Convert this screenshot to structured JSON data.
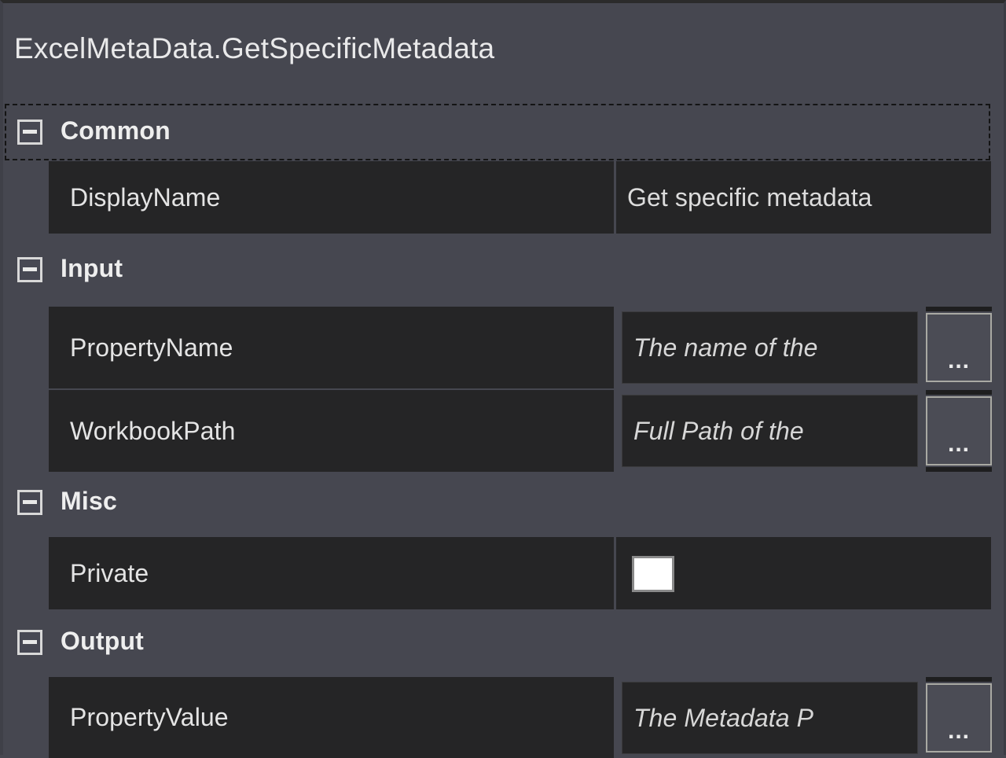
{
  "panel": {
    "title": "ExcelMetaData.GetSpecificMetadata"
  },
  "categories": [
    {
      "id": "common",
      "label": "Common",
      "expander_icon": "collapse-minus-icon",
      "expanded": true,
      "selected": true
    },
    {
      "id": "input",
      "label": "Input",
      "expander_icon": "collapse-minus-icon",
      "expanded": true,
      "selected": false
    },
    {
      "id": "misc",
      "label": "Misc",
      "expander_icon": "collapse-minus-icon",
      "expanded": true,
      "selected": false
    },
    {
      "id": "output",
      "label": "Output",
      "expander_icon": "collapse-minus-icon",
      "expanded": true,
      "selected": false
    }
  ],
  "properties": {
    "display_name": {
      "name": "DisplayName",
      "value": "Get specific metadata",
      "editor": "text"
    },
    "property_name": {
      "name": "PropertyName",
      "value": "The name of the",
      "placeholder": "The name of the",
      "editor": "expression",
      "browse_label": "..."
    },
    "workbook_path": {
      "name": "WorkbookPath",
      "value": "Full Path of the",
      "placeholder": "Full Path of the",
      "editor": "expression",
      "browse_label": "..."
    },
    "private": {
      "name": "Private",
      "value": "",
      "checked": false,
      "editor": "checkbox"
    },
    "property_value": {
      "name": "PropertyValue",
      "value": "The Metadata P",
      "placeholder": "The Metadata P",
      "editor": "expression",
      "browse_label": "..."
    }
  },
  "colors": {
    "panel_background": "#464750",
    "row_background": "#252526",
    "text": "#e6e6e6",
    "checkbox_fill": "#ffffff",
    "selection_border": "#141414",
    "button_border": "#a9a9a3"
  }
}
